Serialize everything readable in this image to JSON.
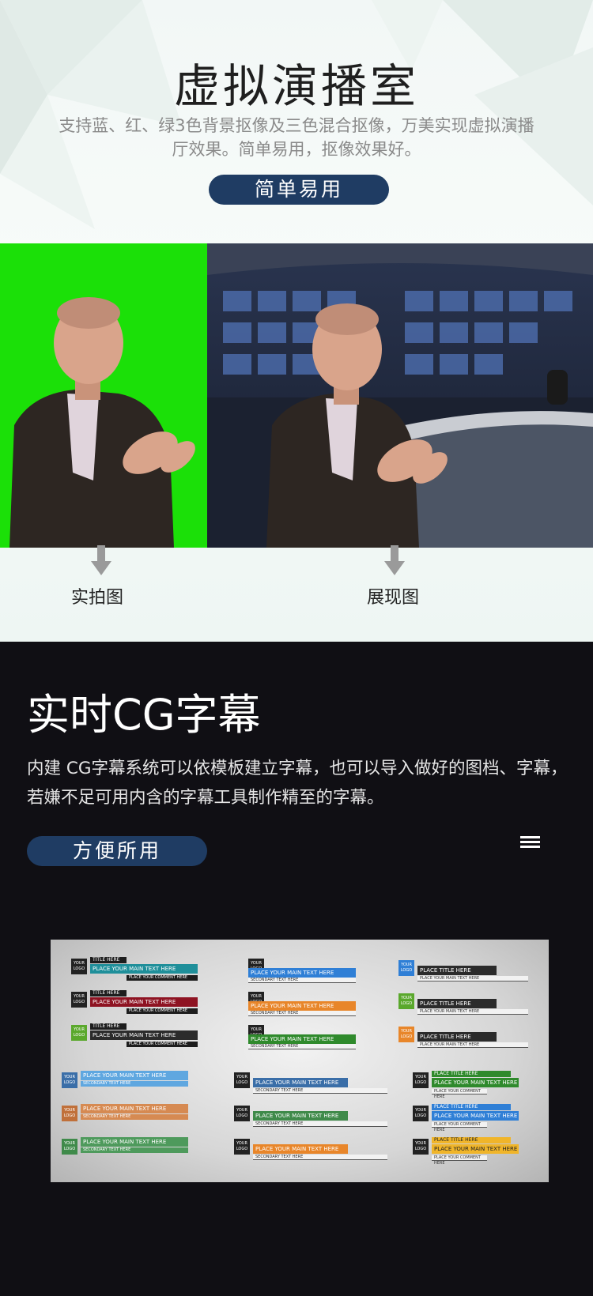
{
  "section1": {
    "title": "虚拟演播室",
    "description": "支持蓝、红、绿3色背景抠像及三色混合抠像，万美实现虚拟演播厅效果。简单易用，抠像效果好。",
    "badge_label": "简单易用",
    "captions": {
      "left": "实拍图",
      "right": "展现图"
    },
    "colors": {
      "green_screen": "#1be008",
      "pill": "#1f3c63"
    }
  },
  "section2": {
    "title": "实时CG字幕",
    "description": "内建 CG字幕系统可以依模板建立字幕，也可以导入做好的图档、字幕，若嫌不足可用内含的字幕工具制作精至的字幕。",
    "badge_label": "方便所用",
    "menu_icon": "hamburger-icon",
    "cg_templates": {
      "logo_text": "YOUR LOGO",
      "title_here": "TITLE HERE",
      "place_title_here": "PLACE TITLE HERE",
      "main_text": "PLACE YOUR MAIN TEXT HERE",
      "secondary_text": "SECONDARY TEXT HERE",
      "comment_text": "PLACE YOUR COMMENT HERE"
    }
  }
}
